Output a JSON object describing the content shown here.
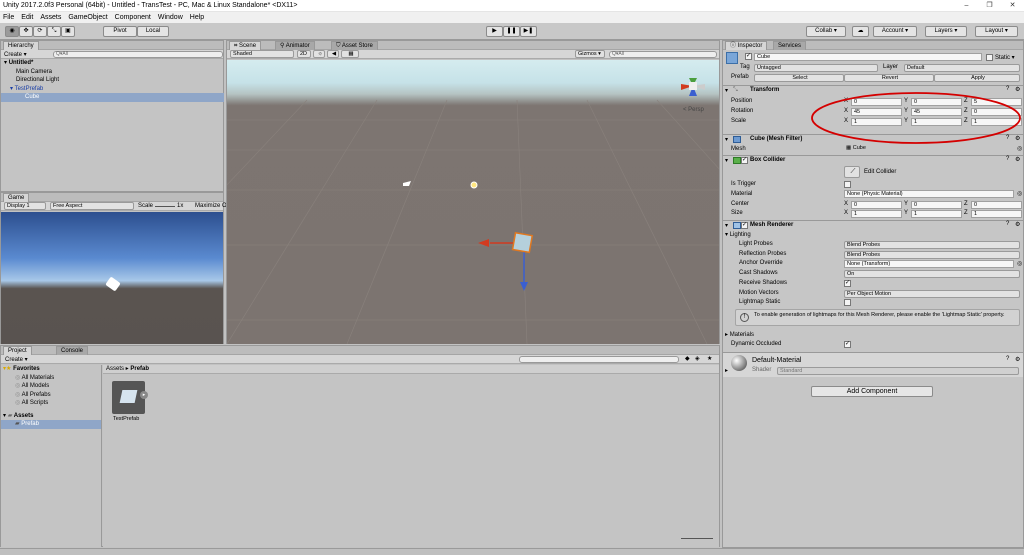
{
  "title": "Unity 2017.2.0f3 Personal (64bit) - Untitled - TransTest - PC, Mac & Linux Standalone* <DX11>",
  "menu": [
    "File",
    "Edit",
    "Assets",
    "GameObject",
    "Component",
    "Window",
    "Help"
  ],
  "toolbar": {
    "pivot": "Pivot",
    "local": "Local",
    "collab": "Collab ▾",
    "account": "Account ▾",
    "layers": "Layers ▾",
    "layout": "Layout ▾"
  },
  "hierarchy": {
    "tab": "Hierarchy",
    "create": "Create ▾",
    "search": "Q▾All",
    "scene": "Untitled*",
    "items": [
      "Main Camera",
      "Directional Light",
      "TestPrefab",
      "Cube"
    ]
  },
  "scene": {
    "tabs": [
      "Scene",
      "Animator",
      "Asset Store"
    ],
    "shaded": "Shaded",
    "mode2d": "2D",
    "gizmos": "Gizmos ▾",
    "search": "Q▾All",
    "persp": "< Persp"
  },
  "game": {
    "tab": "Game",
    "display": "Display 1",
    "aspect": "Free Aspect",
    "scale": "Scale",
    "scale_val": "1x",
    "maximize": "Maximize O"
  },
  "project": {
    "tabs": [
      "Project",
      "Console"
    ],
    "create": "Create ▾",
    "favorites": "Favorites",
    "fav_items": [
      "All Materials",
      "All Models",
      "All Prefabs",
      "All Scripts"
    ],
    "assets": "Assets",
    "prefab": "Prefab",
    "breadcrumb": [
      "Assets",
      "Prefab"
    ],
    "item": "TestPrefab"
  },
  "inspector": {
    "tabs": [
      "Inspector",
      "Services"
    ],
    "name": "Cube",
    "static": "Static ▾",
    "tag_label": "Tag",
    "tag": "Untagged",
    "layer_label": "Layer",
    "layer": "Default",
    "prefab_label": "Prefab",
    "prefab_btns": [
      "Select",
      "Revert",
      "Apply"
    ],
    "transform": {
      "title": "Transform",
      "rows": [
        {
          "label": "Position",
          "x": "0",
          "y": "0",
          "z": "5"
        },
        {
          "label": "Rotation",
          "x": "45",
          "y": "45",
          "z": "0"
        },
        {
          "label": "Scale",
          "x": "1",
          "y": "1",
          "z": "1"
        }
      ]
    },
    "mesh_filter": {
      "title": "Cube (Mesh Filter)",
      "mesh_label": "Mesh",
      "mesh": "Cube"
    },
    "box_collider": {
      "title": "Box Collider",
      "edit": "Edit Collider",
      "is_trigger": "Is Trigger",
      "material_label": "Material",
      "material": "None (Physic Material)",
      "center_label": "Center",
      "center": [
        "0",
        "0",
        "0"
      ],
      "size_label": "Size",
      "size": [
        "1",
        "1",
        "1"
      ]
    },
    "mesh_renderer": {
      "title": "Mesh Renderer",
      "lighting": "Lighting",
      "rows": [
        {
          "label": "Light Probes",
          "value": "Blend Probes"
        },
        {
          "label": "Reflection Probes",
          "value": "Blend Probes"
        },
        {
          "label": "Anchor Override",
          "value": "None (Transform)"
        },
        {
          "label": "Cast Shadows",
          "value": "On"
        },
        {
          "label": "Receive Shadows",
          "value": "✓"
        },
        {
          "label": "Motion Vectors",
          "value": "Per Object Motion"
        },
        {
          "label": "Lightmap Static",
          "value": ""
        }
      ],
      "info": "To enable generation of lightmaps for this Mesh Renderer, please enable the 'Lightmap Static' property.",
      "materials": "Materials",
      "dynamic_occluded": "Dynamic Occluded"
    },
    "material": {
      "name": "Default-Material",
      "shader_label": "Shader",
      "shader": "Standard"
    },
    "add_component": "Add Component"
  },
  "colors": {
    "selection": "#3e7bde",
    "annotation": "#d40000",
    "scene_bg": "#7c7470",
    "sky": "#c9e5ec"
  }
}
